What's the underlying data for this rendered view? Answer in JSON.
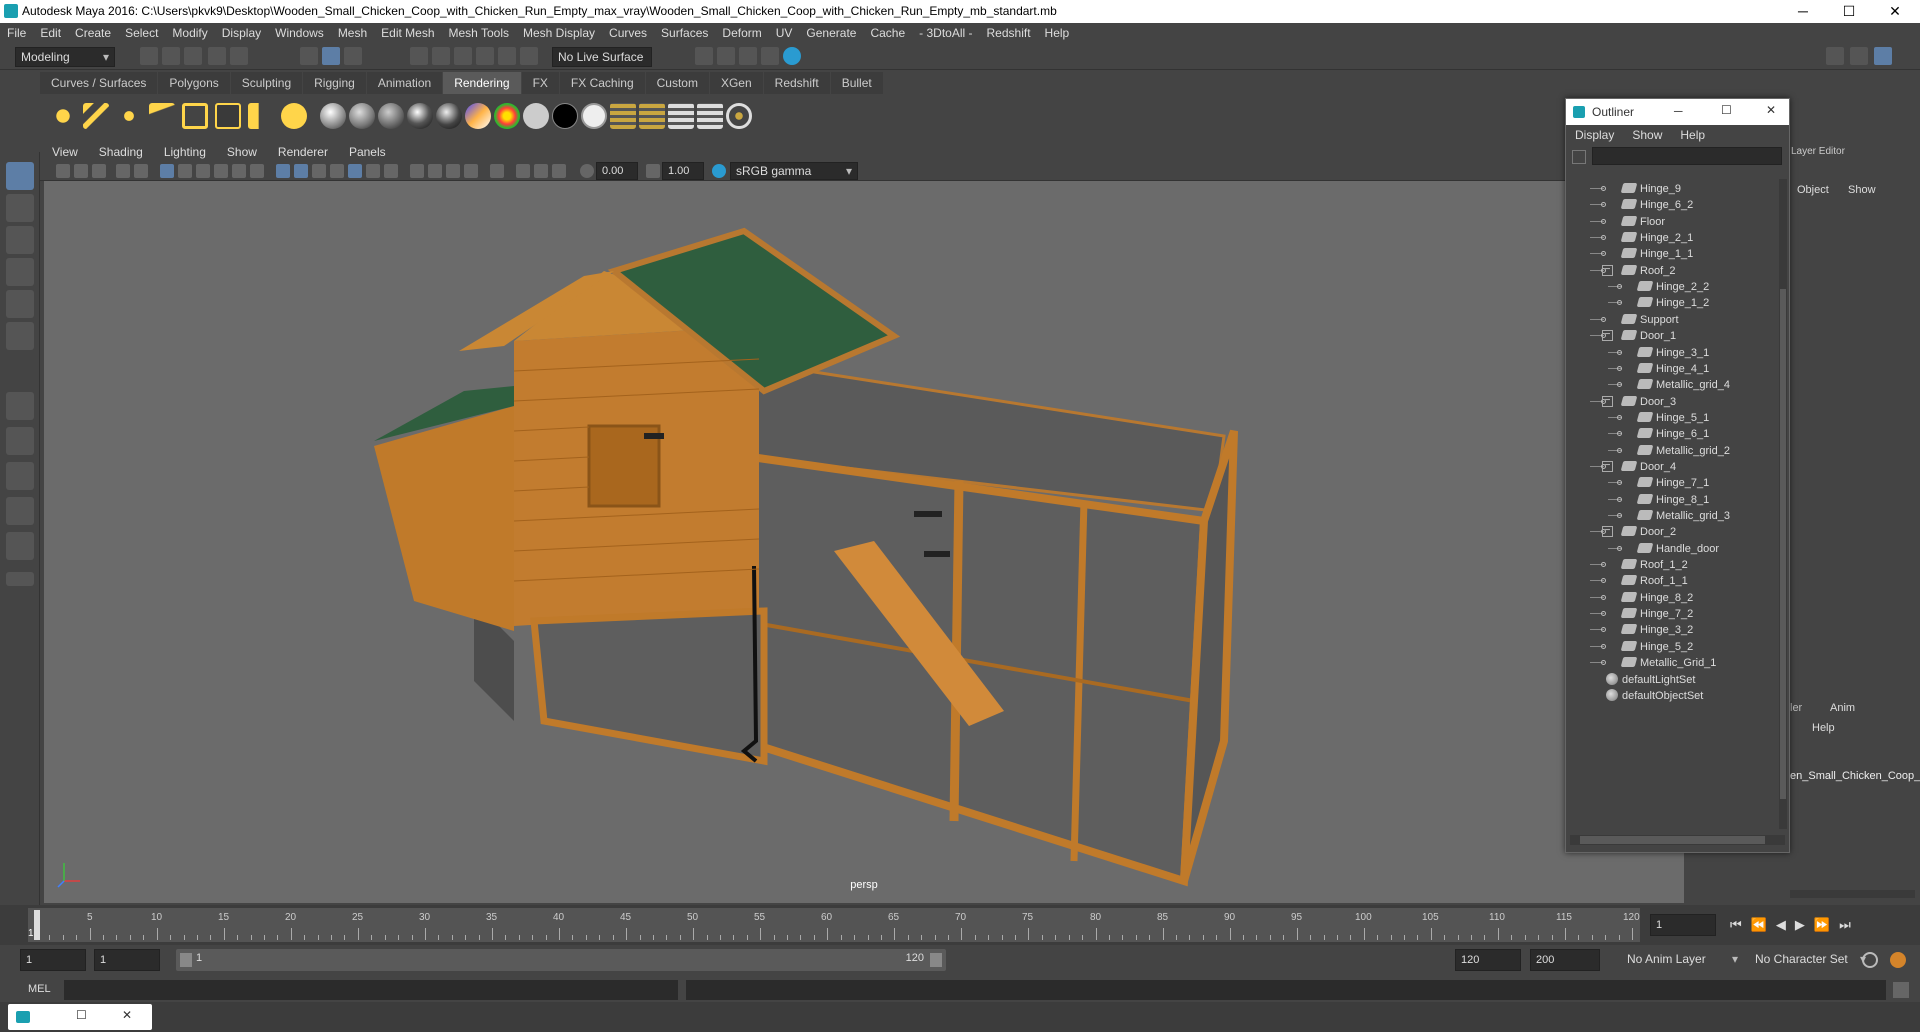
{
  "window": {
    "title": "Autodesk Maya 2016: C:\\Users\\pkvk9\\Desktop\\Wooden_Small_Chicken_Coop_with_Chicken_Run_Empty_max_vray\\Wooden_Small_Chicken_Coop_with_Chicken_Run_Empty_mb_standart.mb",
    "minimize": "─",
    "maximize": "☐",
    "close": "✕"
  },
  "menubar": [
    "File",
    "Edit",
    "Create",
    "Select",
    "Modify",
    "Display",
    "Windows",
    "Mesh",
    "Edit Mesh",
    "Mesh Tools",
    "Mesh Display",
    "Curves",
    "Surfaces",
    "Deform",
    "UV",
    "Generate",
    "Cache",
    "- 3DtoAll -",
    "Redshift",
    "Help"
  ],
  "statusline": {
    "mode": "Modeling",
    "live_surface": "No Live Surface"
  },
  "shelf": {
    "tabs": [
      "Curves / Surfaces",
      "Polygons",
      "Sculpting",
      "Rigging",
      "Animation",
      "Rendering",
      "FX",
      "FX Caching",
      "Custom",
      "XGen",
      "Redshift",
      "Bullet"
    ],
    "active_tab": "Rendering"
  },
  "panel": {
    "menu": [
      "View",
      "Shading",
      "Lighting",
      "Show",
      "Renderer",
      "Panels"
    ],
    "exposure": "0.00",
    "gamma": "1.00",
    "color_space": "sRGB gamma",
    "camera_label": "persp"
  },
  "outliner": {
    "title": "Outliner",
    "menu": [
      "Display",
      "Show",
      "Help"
    ],
    "items": [
      {
        "label": "Hinge_9",
        "depth": 1,
        "kind": "mesh"
      },
      {
        "label": "Hinge_6_2",
        "depth": 1,
        "kind": "mesh"
      },
      {
        "label": "Floor",
        "depth": 1,
        "kind": "mesh"
      },
      {
        "label": "Hinge_2_1",
        "depth": 1,
        "kind": "mesh"
      },
      {
        "label": "Hinge_1_1",
        "depth": 1,
        "kind": "mesh"
      },
      {
        "label": "Roof_2",
        "depth": 1,
        "kind": "mesh",
        "expanded": true
      },
      {
        "label": "Hinge_2_2",
        "depth": 2,
        "kind": "mesh"
      },
      {
        "label": "Hinge_1_2",
        "depth": 2,
        "kind": "mesh"
      },
      {
        "label": "Support",
        "depth": 1,
        "kind": "mesh"
      },
      {
        "label": "Door_1",
        "depth": 1,
        "kind": "mesh",
        "expanded": true
      },
      {
        "label": "Hinge_3_1",
        "depth": 2,
        "kind": "mesh"
      },
      {
        "label": "Hinge_4_1",
        "depth": 2,
        "kind": "mesh"
      },
      {
        "label": "Metallic_grid_4",
        "depth": 2,
        "kind": "mesh"
      },
      {
        "label": "Door_3",
        "depth": 1,
        "kind": "mesh",
        "expanded": true
      },
      {
        "label": "Hinge_5_1",
        "depth": 2,
        "kind": "mesh"
      },
      {
        "label": "Hinge_6_1",
        "depth": 2,
        "kind": "mesh"
      },
      {
        "label": "Metallic_grid_2",
        "depth": 2,
        "kind": "mesh"
      },
      {
        "label": "Door_4",
        "depth": 1,
        "kind": "mesh",
        "expanded": true
      },
      {
        "label": "Hinge_7_1",
        "depth": 2,
        "kind": "mesh"
      },
      {
        "label": "Hinge_8_1",
        "depth": 2,
        "kind": "mesh"
      },
      {
        "label": "Metallic_grid_3",
        "depth": 2,
        "kind": "mesh"
      },
      {
        "label": "Door_2",
        "depth": 1,
        "kind": "mesh",
        "expanded": true
      },
      {
        "label": "Handle_door",
        "depth": 2,
        "kind": "mesh"
      },
      {
        "label": "Roof_1_2",
        "depth": 1,
        "kind": "mesh"
      },
      {
        "label": "Roof_1_1",
        "depth": 1,
        "kind": "mesh"
      },
      {
        "label": "Hinge_8_2",
        "depth": 1,
        "kind": "mesh"
      },
      {
        "label": "Hinge_7_2",
        "depth": 1,
        "kind": "mesh"
      },
      {
        "label": "Hinge_3_2",
        "depth": 1,
        "kind": "mesh"
      },
      {
        "label": "Hinge_5_2",
        "depth": 1,
        "kind": "mesh"
      },
      {
        "label": "Metallic_Grid_1",
        "depth": 1,
        "kind": "mesh"
      },
      {
        "label": "defaultLightSet",
        "depth": 0,
        "kind": "set"
      },
      {
        "label": "defaultObjectSet",
        "depth": 0,
        "kind": "set"
      }
    ]
  },
  "right_panel": {
    "layer_editor": "Layer Editor",
    "tabs": [
      "Object",
      "Show"
    ],
    "lower_tabs": [
      "ler",
      "Anim"
    ],
    "help": "Help",
    "layer_name": "en_Small_Chicken_Coop_"
  },
  "timeline": {
    "ticks": [
      "5",
      "10",
      "15",
      "20",
      "25",
      "30",
      "35",
      "40",
      "45",
      "50",
      "55",
      "60",
      "65",
      "70",
      "75",
      "80",
      "85",
      "90",
      "95",
      "100",
      "105",
      "110",
      "115",
      "120"
    ],
    "start_marker": "1",
    "current_frame": "1"
  },
  "range": {
    "start": "1",
    "anim_start": "1",
    "slider_start": "1",
    "slider_end": "120",
    "anim_end": "120",
    "end": "200",
    "anim_layer": "No Anim Layer",
    "character_set": "No Character Set"
  },
  "cmdline": {
    "label": "MEL"
  }
}
